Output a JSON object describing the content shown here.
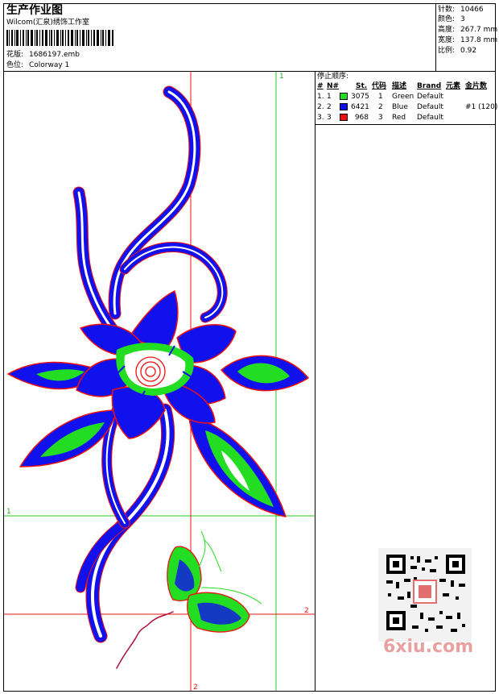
{
  "header": {
    "title": "生产作业图",
    "company": "Wilcom(汇泉)绣饰工作室",
    "design_label": "花版:",
    "design_file": "1686197.emb",
    "color_label": "色位:",
    "colorway": "Colorway 1"
  },
  "stats": {
    "stitches_label": "针数:",
    "stitches": "10466",
    "colors_label": "颜色:",
    "colors": "3",
    "height_label": "高度:",
    "height": "267.7 mm",
    "width_label": "宽度:",
    "width": "137.8 mm",
    "scale_label": "比例:",
    "scale": "0.92"
  },
  "stop_sequence": {
    "title": "停止顺序:",
    "headers": [
      "#",
      "N#",
      "St.",
      "代码",
      "描述",
      "Brand",
      "元素",
      "金片数"
    ],
    "rows": [
      {
        "num": "1.",
        "n": "1",
        "color": "#22dd22",
        "st": "3075",
        "code": "1",
        "desc": "Green",
        "brand": "Default",
        "element": "",
        "sequins": ""
      },
      {
        "num": "2.",
        "n": "2",
        "color": "#1111ee",
        "st": "6421",
        "code": "2",
        "desc": "Blue",
        "brand": "Default",
        "element": "",
        "sequins": "#1 (120)"
      },
      {
        "num": "3.",
        "n": "3",
        "color": "#ee1111",
        "st": "968",
        "code": "3",
        "desc": "Red",
        "brand": "Default",
        "element": "",
        "sequins": ""
      }
    ]
  },
  "guides": {
    "green_top_label": "1",
    "green_left_label": "1",
    "red_right_label": "2",
    "red_bottom_label": "2"
  },
  "watermark": "6xiu.com",
  "colors": {
    "green": "#22dd22",
    "blue": "#1111ee",
    "red": "#ee1111"
  }
}
